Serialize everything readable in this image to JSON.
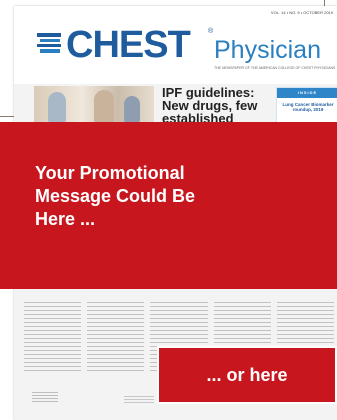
{
  "masthead": {
    "logo": "CHEST",
    "trademark": "®",
    "subtitle": "Physician",
    "issue_line": "VOL. 14 • NO. 9 • OCTOBER 2019",
    "tagline": "THE NEWSPAPER OF THE AMERICAN COLLEGE OF CHEST PHYSICIANS"
  },
  "cover": {
    "headline": "IPF guidelines: New drugs, few established options",
    "sidebar_title": "INSIDE",
    "sidebar_text": "Lung Cancer Biomarker roundup, 2019"
  },
  "promo": {
    "main_message": "Your Promotional Message Could Be Here ...",
    "secondary_message": "... or here"
  },
  "colors": {
    "promo_red": "#c8161f",
    "brand_blue": "#1f5c9e",
    "accent_blue": "#2a7fc0"
  }
}
